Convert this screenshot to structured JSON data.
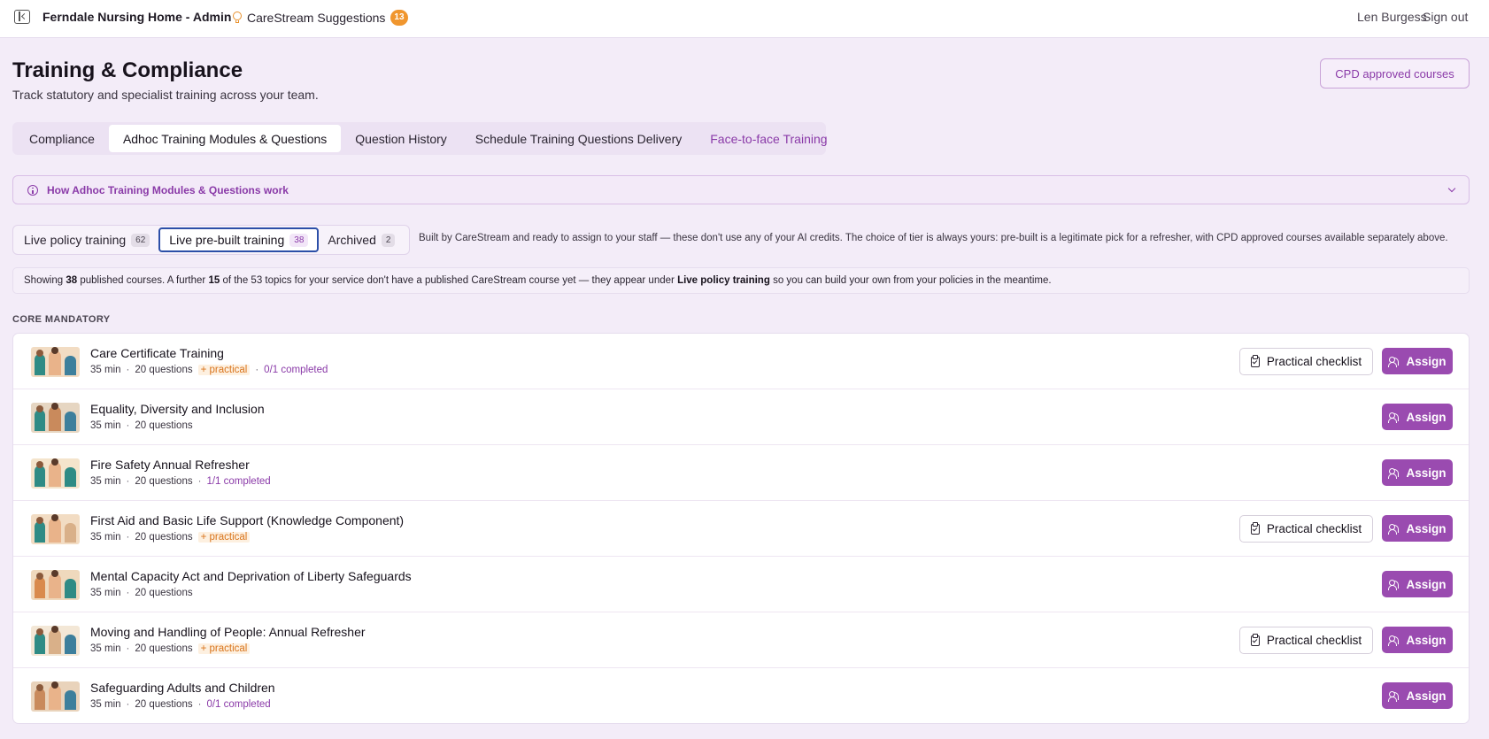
{
  "topbar": {
    "app_title": "Ferndale Nursing Home - Admin",
    "suggestions_label": "CareStream Suggestions",
    "suggestions_count": "13",
    "user_name": "Len Burgess",
    "signout_label": "Sign out"
  },
  "header": {
    "title": "Training & Compliance",
    "subtitle": "Track statutory and specialist training across your team.",
    "cpd_button": "CPD approved courses"
  },
  "main_tabs": [
    {
      "label": "Compliance"
    },
    {
      "label": "Adhoc Training Modules & Questions"
    },
    {
      "label": "Question History"
    },
    {
      "label": "Schedule Training Questions Delivery"
    },
    {
      "label": "Face-to-face Training"
    }
  ],
  "info_panel": {
    "label": "How Adhoc Training Modules & Questions work"
  },
  "sub_tabs": [
    {
      "label": "Live policy training",
      "count": "62"
    },
    {
      "label": "Live pre-built training",
      "count": "38"
    },
    {
      "label": "Archived",
      "count": "2"
    }
  ],
  "prebuilt_description": "Built by CareStream and ready to assign to your staff — these don't use any of your AI credits. The choice of tier is always yours: pre-built is a legitimate pick for a refresher, with CPD approved courses available separately above.",
  "showing_banner": {
    "prefix": "Showing",
    "published_count": "38",
    "part1": "published courses. A further",
    "unpublished_count": "15",
    "part2": "of the 53 topics for your service don't have a published CareStream course yet — they appear under",
    "link_label": "Live policy training",
    "part3": "so you can build your own from your policies in the meantime."
  },
  "section_heading": "CORE MANDATORY",
  "labels": {
    "practical_checklist": "Practical checklist",
    "assign": "Assign",
    "sep": "·"
  },
  "courses": [
    {
      "title": "Care Certificate Training",
      "duration": "35 min",
      "questions": "20 questions",
      "practical": "+ practical",
      "completed": "0/1 completed"
    },
    {
      "title": "Equality, Diversity and Inclusion",
      "duration": "35 min",
      "questions": "20 questions",
      "practical": "",
      "completed": ""
    },
    {
      "title": "Fire Safety Annual Refresher",
      "duration": "35 min",
      "questions": "20 questions",
      "practical": "",
      "completed": "1/1 completed"
    },
    {
      "title": "First Aid and Basic Life Support (Knowledge Component)",
      "duration": "35 min",
      "questions": "20 questions",
      "practical": "+ practical",
      "completed": ""
    },
    {
      "title": "Mental Capacity Act and Deprivation of Liberty Safeguards",
      "duration": "35 min",
      "questions": "20 questions",
      "practical": "",
      "completed": ""
    },
    {
      "title": "Moving and Handling of People: Annual Refresher",
      "duration": "35 min",
      "questions": "20 questions",
      "practical": "+ practical",
      "completed": ""
    },
    {
      "title": "Safeguarding Adults and Children",
      "duration": "35 min",
      "questions": "20 questions",
      "practical": "",
      "completed": "0/1 completed"
    }
  ],
  "colors": {
    "accent": "#9a4bb0",
    "badge": "#f0962e",
    "practical": "#d9741c",
    "background": "#f3ecf8"
  }
}
